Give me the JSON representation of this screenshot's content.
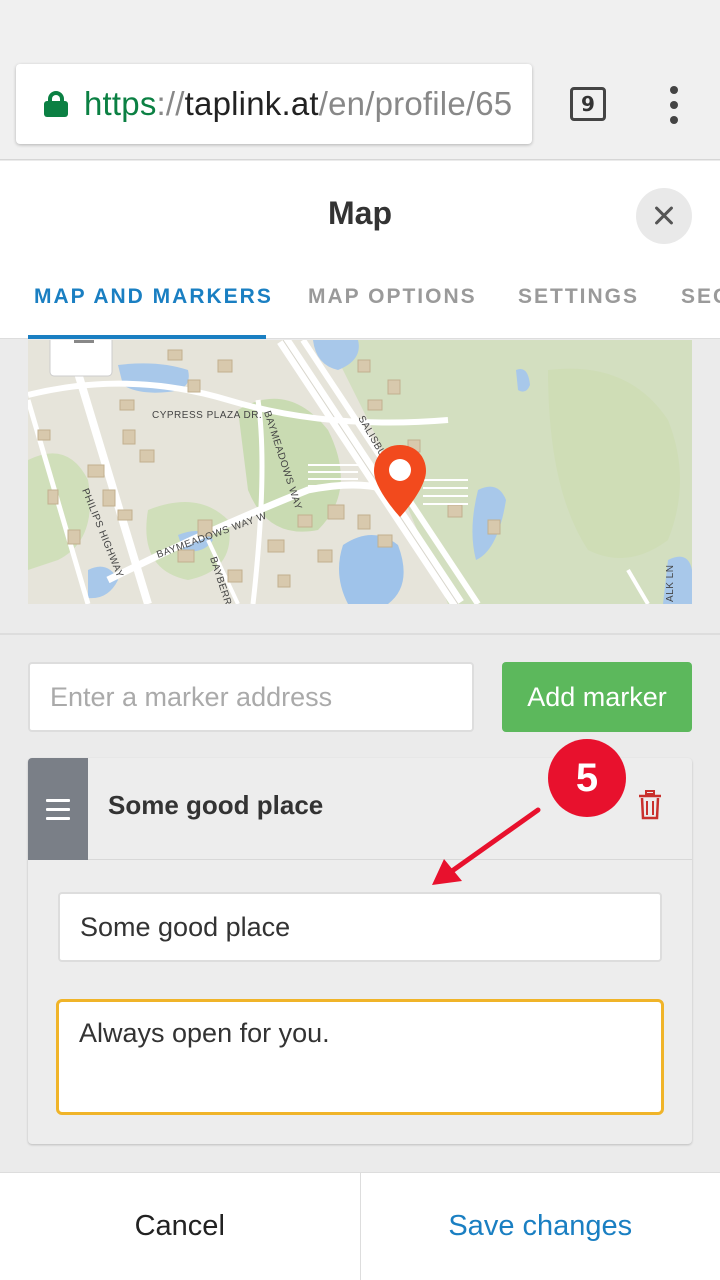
{
  "browser": {
    "url": {
      "scheme": "https",
      "separator": "://",
      "host": "taplink.at",
      "path": "/en/profile/65"
    },
    "tab_count": "9",
    "menu_icon": "kebab-menu-icon",
    "secure_icon": "lock-icon",
    "secure_color": "#0b8043"
  },
  "modal": {
    "title": "Map",
    "close_icon": "close-icon",
    "tabs": [
      {
        "label": "MAP AND MARKERS",
        "active": true
      },
      {
        "label": "MAP OPTIONS",
        "active": false
      },
      {
        "label": "SETTINGS",
        "active": false
      },
      {
        "label": "SEC",
        "active": false
      }
    ],
    "map": {
      "streets": [
        "CYPRESS PLAZA DR.",
        "BAYMEADOWS WAY",
        "SALISBU",
        "PHILIPS HIGHWAY",
        "BAYMEADOWS WAY W",
        "BAYBERRY R",
        "ALK LN"
      ],
      "marker_icon": "map-pin-icon",
      "marker_color": "#f24a1d"
    },
    "marker_input": {
      "placeholder": "Enter a marker address",
      "value": ""
    },
    "add_marker_label": "Add marker",
    "marker": {
      "title": "Some good place",
      "name_value": "Some good place",
      "description_value": "Always open for you.",
      "drag_icon": "drag-handle-icon",
      "delete_icon": "trash-icon",
      "delete_color": "#c9302c"
    },
    "annotation": {
      "step_number": "5",
      "color": "#e8112d"
    },
    "footer": {
      "cancel_label": "Cancel",
      "save_label": "Save changes"
    },
    "accent_color": "#1a7fc2",
    "add_button_color": "#5cb85c"
  }
}
